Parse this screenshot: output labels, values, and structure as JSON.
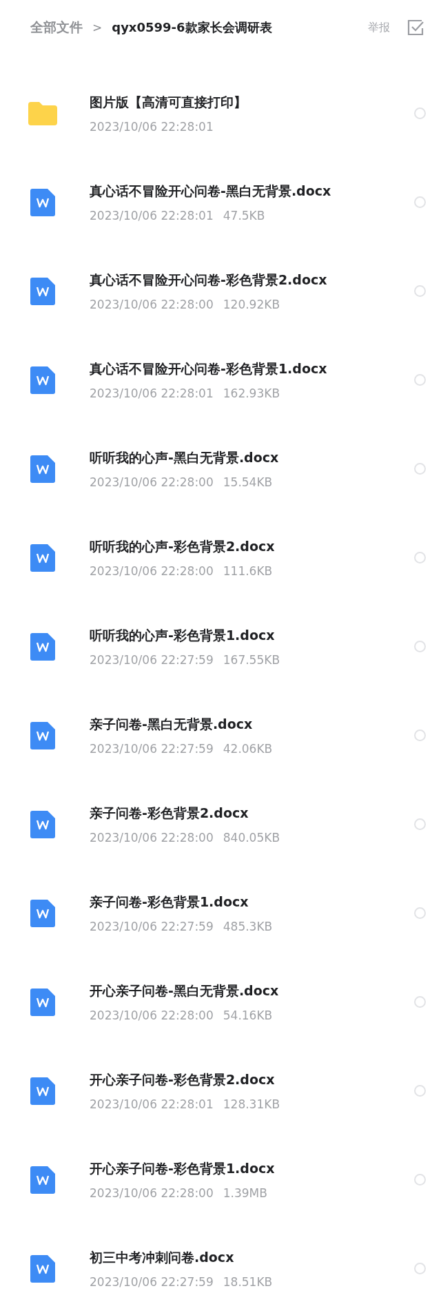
{
  "breadcrumb": {
    "root": "全部文件",
    "separator": ">",
    "current": "qyx0599-6款家长会调研表"
  },
  "report_button": "举报",
  "files": [
    {
      "kind": "folder",
      "name": "图片版【高清可直接打印】",
      "date": "2023/10/06 22:28:01",
      "selected": false
    },
    {
      "kind": "docx",
      "name": "真心话不冒险开心问卷-黑白无背景.docx",
      "date": "2023/10/06 22:28:01",
      "size": "47.5KB",
      "selected": false
    },
    {
      "kind": "docx",
      "name": "真心话不冒险开心问卷-彩色背景2.docx",
      "date": "2023/10/06 22:28:00",
      "size": "120.92KB",
      "selected": false
    },
    {
      "kind": "docx",
      "name": "真心话不冒险开心问卷-彩色背景1.docx",
      "date": "2023/10/06 22:28:01",
      "size": "162.93KB",
      "selected": false
    },
    {
      "kind": "docx",
      "name": "听听我的心声-黑白无背景.docx",
      "date": "2023/10/06 22:28:00",
      "size": "15.54KB",
      "selected": false
    },
    {
      "kind": "docx",
      "name": "听听我的心声-彩色背景2.docx",
      "date": "2023/10/06 22:28:00",
      "size": "111.6KB",
      "selected": false
    },
    {
      "kind": "docx",
      "name": "听听我的心声-彩色背景1.docx",
      "date": "2023/10/06 22:27:59",
      "size": "167.55KB",
      "selected": false
    },
    {
      "kind": "docx",
      "name": "亲子问卷-黑白无背景.docx",
      "date": "2023/10/06 22:27:59",
      "size": "42.06KB",
      "selected": false
    },
    {
      "kind": "docx",
      "name": "亲子问卷-彩色背景2.docx",
      "date": "2023/10/06 22:28:00",
      "size": "840.05KB",
      "selected": false
    },
    {
      "kind": "docx",
      "name": "亲子问卷-彩色背景1.docx",
      "date": "2023/10/06 22:27:59",
      "size": "485.3KB",
      "selected": false
    },
    {
      "kind": "docx",
      "name": "开心亲子问卷-黑白无背景.docx",
      "date": "2023/10/06 22:28:00",
      "size": "54.16KB",
      "selected": false
    },
    {
      "kind": "docx",
      "name": "开心亲子问卷-彩色背景2.docx",
      "date": "2023/10/06 22:28:01",
      "size": "128.31KB",
      "selected": false
    },
    {
      "kind": "docx",
      "name": "开心亲子问卷-彩色背景1.docx",
      "date": "2023/10/06 22:28:00",
      "size": "1.39MB",
      "selected": false
    },
    {
      "kind": "docx",
      "name": "初三中考冲刺问卷.docx",
      "date": "2023/10/06 22:27:59",
      "size": "18.51KB",
      "selected": false
    }
  ]
}
